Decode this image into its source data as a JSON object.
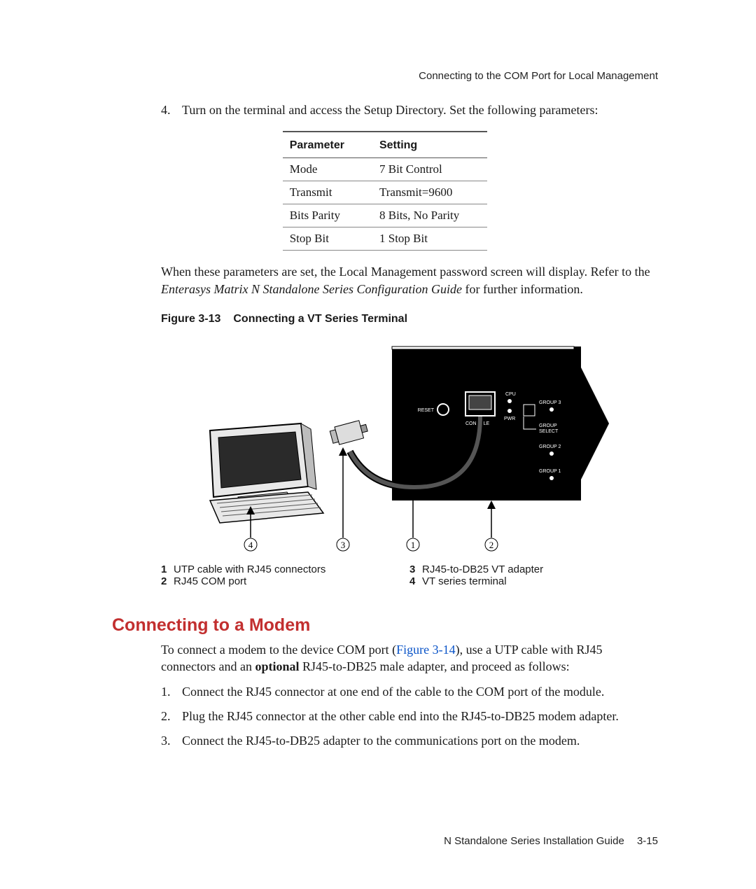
{
  "header": "Connecting to the COM Port for Local Management",
  "step4": {
    "num": "4.",
    "text": "Turn on the terminal and access the Setup Directory. Set the following parameters:"
  },
  "table": {
    "headers": [
      "Parameter",
      "Setting"
    ],
    "rows": [
      [
        "Mode",
        "7 Bit Control"
      ],
      [
        "Transmit",
        "Transmit=9600"
      ],
      [
        "Bits Parity",
        "8 Bits, No Parity"
      ],
      [
        "Stop Bit",
        "1 Stop Bit"
      ]
    ]
  },
  "after_table": {
    "t1": "When these parameters are set, the Local Management password screen will display. Refer to the ",
    "em": "Enterasys Matrix N Standalone Series Configuration Guide",
    "t2": " for further information."
  },
  "figure": {
    "label": "Figure 3-13",
    "title": "Connecting a VT Series Terminal",
    "device_labels": {
      "cpu": "CPU",
      "reset": "RESET",
      "console": "CONSOLE",
      "pwr": "PWR",
      "group3": "GROUP 3",
      "group2": "GROUP 2",
      "group1": "GROUP 1",
      "group_select_a": "GROUP",
      "group_select_b": "SELECT"
    },
    "callouts": [
      "④",
      "③",
      "①",
      "②"
    ]
  },
  "legend": [
    {
      "num": "1",
      "text": "UTP cable with RJ45 connectors"
    },
    {
      "num": "2",
      "text": "RJ45 COM port"
    },
    {
      "num": "3",
      "text": "RJ45-to-DB25 VT adapter"
    },
    {
      "num": "4",
      "text": "VT series terminal"
    }
  ],
  "section_heading": "Connecting to a Modem",
  "modem_intro": {
    "t1": "To connect a modem to the device COM port (",
    "xref": "Figure 3-14",
    "t2": "), use a UTP cable with RJ45 connectors and an ",
    "bold": "optional",
    "t3": " RJ45-to-DB25 male adapter, and proceed as follows:"
  },
  "modem_steps": [
    {
      "num": "1.",
      "text": "Connect the RJ45 connector at one end of the cable to the COM port of the module."
    },
    {
      "num": "2.",
      "text": "Plug the RJ45 connector at the other cable end into the RJ45-to-DB25 modem adapter."
    },
    {
      "num": "3.",
      "text": "Connect the RJ45-to-DB25 adapter to the communications port on the modem."
    }
  ],
  "footer": {
    "guide": "N Standalone Series Installation Guide",
    "page": "3-15"
  }
}
